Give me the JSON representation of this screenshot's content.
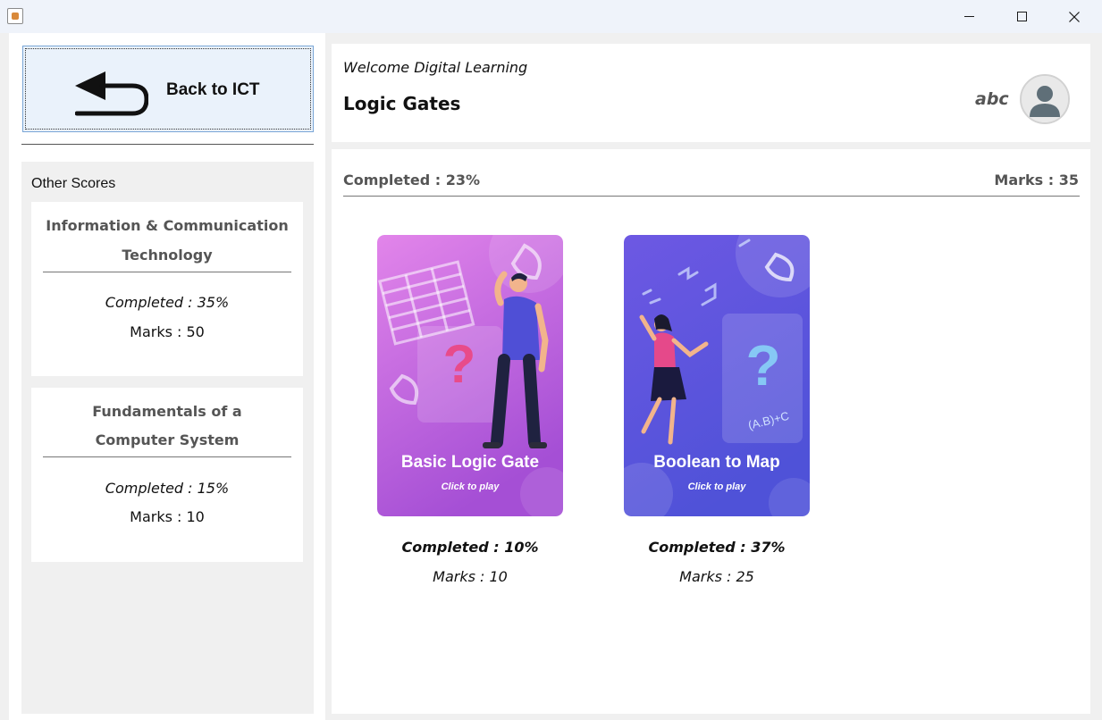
{
  "window": {
    "icon": "java-app-icon",
    "controls": [
      "minimize-icon",
      "maximize-icon",
      "close-icon"
    ]
  },
  "sidebar": {
    "back_button_label": "Back to ICT",
    "back_icon": "back-arrow-icon",
    "other_scores_title": "Other Scores",
    "scores": [
      {
        "title_line1": "Information & Communication",
        "title_line2": "Technology",
        "completed": "Completed : 35%",
        "marks": "Marks : 50"
      },
      {
        "title_line1": "Fundamentals of a",
        "title_line2": "Computer System",
        "completed": "Completed : 15%",
        "marks": "Marks : 10"
      }
    ]
  },
  "header": {
    "welcome": "Welcome Digital Learning",
    "title": "Logic Gates",
    "username": "abc",
    "avatar_icon": "user-avatar-icon"
  },
  "content": {
    "completed": "Completed : 23%",
    "marks": "Marks : 35",
    "games": [
      {
        "title": "Basic Logic Gate",
        "subtitle": "Click to play",
        "completed": "Completed : 10%",
        "marks": "Marks : 10",
        "color_top": "#e07be6",
        "color_bottom": "#a24fd6"
      },
      {
        "title": "Boolean to Map",
        "subtitle": "Click to play",
        "completed": "Completed : 37%",
        "marks": "Marks : 25",
        "color_top": "#6c5ce7",
        "color_bottom": "#4e4fd6"
      }
    ]
  }
}
